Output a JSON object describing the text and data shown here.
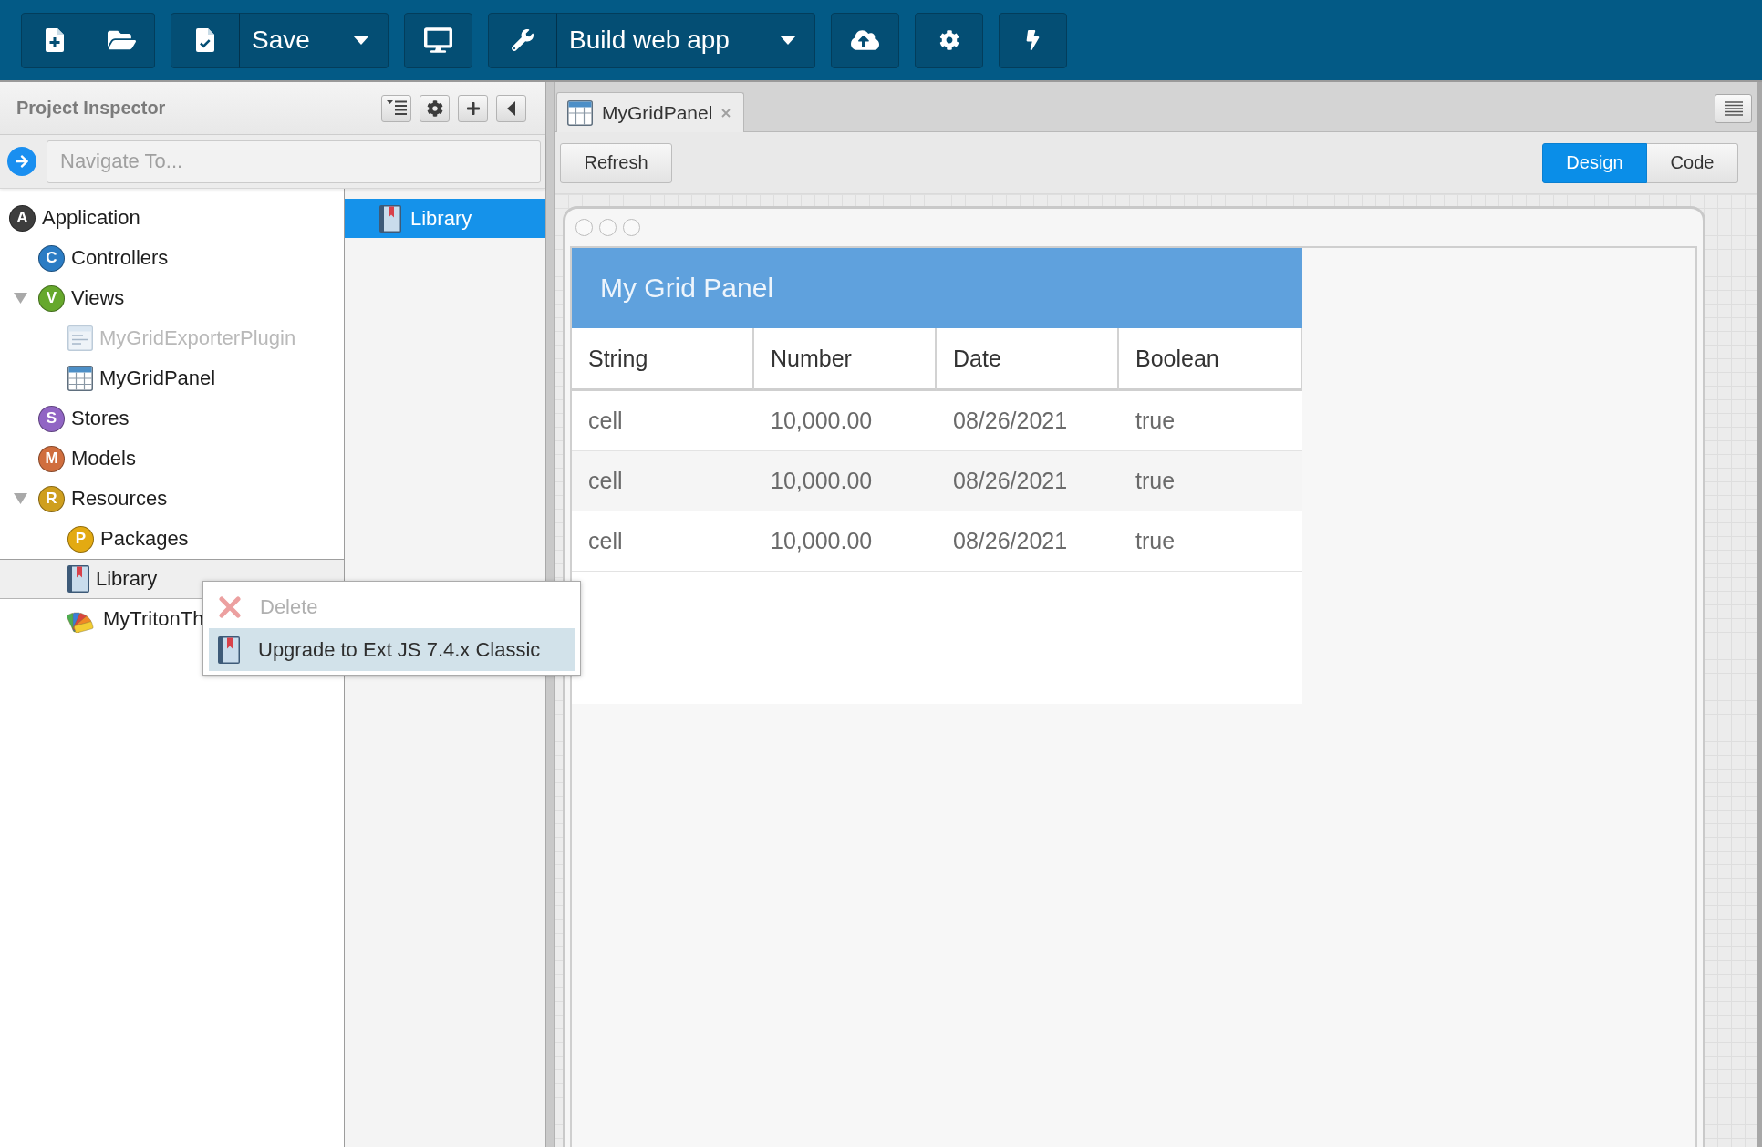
{
  "toolbar": {
    "save": {
      "label": "Save"
    },
    "build": {
      "label": "Build web app"
    }
  },
  "project_inspector": {
    "title": "Project Inspector",
    "navigate": {
      "placeholder": "Navigate To..."
    },
    "tree": [
      {
        "label": "Application",
        "kind": "badge",
        "badge": "A",
        "color": "#3d3d3d",
        "selected": false,
        "disabled": false,
        "children": [
          {
            "label": "Controllers",
            "kind": "badge",
            "badge": "C",
            "color": "#2b7cc4",
            "selected": false,
            "disabled": false
          },
          {
            "label": "Views",
            "kind": "badge",
            "badge": "V",
            "color": "#66a82c",
            "selected": false,
            "disabled": false,
            "expanded": true,
            "children": [
              {
                "label": "MyGridExporterPlugin",
                "kind": "plugin",
                "selected": false,
                "disabled": true
              },
              {
                "label": "MyGridPanel",
                "kind": "grid",
                "selected": false,
                "disabled": false
              }
            ]
          },
          {
            "label": "Stores",
            "kind": "badge",
            "badge": "S",
            "color": "#9165c4",
            "selected": false,
            "disabled": false
          },
          {
            "label": "Models",
            "kind": "badge",
            "badge": "M",
            "color": "#d06e3e",
            "selected": false,
            "disabled": false
          },
          {
            "label": "Resources",
            "kind": "badge",
            "badge": "R",
            "color": "#cf9f1e",
            "selected": false,
            "disabled": false,
            "expanded": true,
            "children": [
              {
                "label": "Packages",
                "kind": "badge",
                "badge": "P",
                "color": "#e3aa12",
                "selected": false,
                "disabled": false
              },
              {
                "label": "Library",
                "kind": "library",
                "selected": true,
                "disabled": false
              },
              {
                "label": "MyTritonTh",
                "kind": "theme",
                "selected": false,
                "disabled": false
              }
            ]
          }
        ]
      }
    ],
    "details": [
      {
        "label": "Library",
        "kind": "library",
        "selected": true
      }
    ]
  },
  "context_menu": {
    "items": [
      {
        "label": "Delete",
        "kind": "delete",
        "disabled": true,
        "selected": false
      },
      {
        "label": "Upgrade to Ext JS 7.4.x Classic",
        "kind": "library",
        "disabled": false,
        "selected": true
      }
    ]
  },
  "editor": {
    "tabs": [
      {
        "label": "MyGridPanel",
        "kind": "grid",
        "selected": true
      }
    ],
    "refresh": {
      "label": "Refresh"
    },
    "view_modes": [
      {
        "label": "Design",
        "selected": true
      },
      {
        "label": "Code",
        "selected": false
      }
    ],
    "grid_panel": {
      "title": "My Grid Panel",
      "columns": [
        "String",
        "Number",
        "Date",
        "Boolean"
      ],
      "rows": [
        [
          "cell",
          "10,000.00",
          "08/26/2021",
          "true"
        ],
        [
          "cell",
          "10,000.00",
          "08/26/2021",
          "true"
        ],
        [
          "cell",
          "10,000.00",
          "08/26/2021",
          "true"
        ]
      ]
    }
  }
}
